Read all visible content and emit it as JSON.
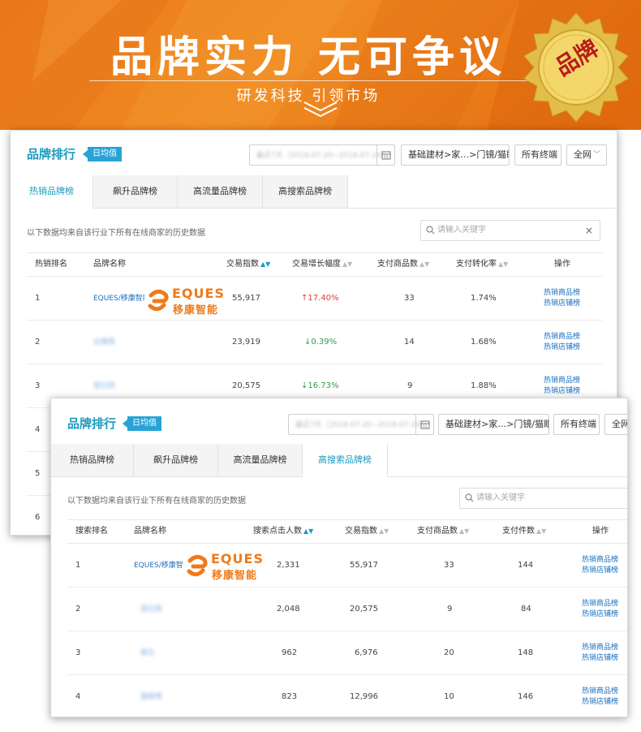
{
  "banner": {
    "title": "品牌实力 无可争议",
    "subtitle": "研发科技 引领市场",
    "seal_text": "品牌",
    "colors": {
      "orange": "#ef7f1a",
      "gold": "#d9b13a",
      "seal_red": "#b71c1c"
    }
  },
  "panel1": {
    "title": "品牌排行",
    "badge": "日均值",
    "date_range": "最近7天（2018-07-20~2018-07-26）",
    "category": "基础建材>家…>门镜/猫眼",
    "terminal": "所有终端",
    "network": "全网",
    "tabs": [
      "热销品牌榜",
      "飙升品牌榜",
      "高流量品牌榜",
      "高搜索品牌榜"
    ],
    "active_tab": 0,
    "note": "以下数据均来自该行业下所有在线商家的历史数据",
    "search_placeholder": "请输入关键字",
    "columns": [
      "热销排名",
      "品牌名称",
      "交易指数",
      "交易增长幅度",
      "支付商品数",
      "支付转化率",
      "操作"
    ],
    "rows": [
      {
        "rank": "1",
        "brand": "EQUES/移康智能",
        "trade_index": "55,917",
        "growth": "17.40%",
        "growth_dir": "up",
        "goods": "33",
        "conv": "1.74%",
        "op1": "热销商品榜",
        "op2": "热销店铺榜"
      },
      {
        "rank": "2",
        "brand": "云瞳等",
        "trade_index": "23,919",
        "growth": "0.39%",
        "growth_dir": "down",
        "goods": "14",
        "conv": "1.68%",
        "op1": "热销商品榜",
        "op2": "热销店铺榜"
      },
      {
        "rank": "3",
        "brand": "萤石购",
        "trade_index": "20,575",
        "growth": "16.73%",
        "growth_dir": "down",
        "goods": "9",
        "conv": "1.88%",
        "op1": "热销商品榜",
        "op2": "热销店铺榜"
      },
      {
        "rank": "4"
      },
      {
        "rank": "5"
      },
      {
        "rank": "6"
      }
    ]
  },
  "panel2": {
    "title": "品牌排行",
    "badge": "日均值",
    "date_range": "最近7天（2018-07-20~2018-07-26）",
    "category": "基础建材>家…>门镜/猫眼",
    "terminal": "所有终端",
    "network": "全网",
    "tabs": [
      "热销品牌榜",
      "飙升品牌榜",
      "高流量品牌榜",
      "高搜索品牌榜"
    ],
    "active_tab": 3,
    "note": "以下数据均来自该行业下所有在线商家的历史数据",
    "search_placeholder": "请输入关键字",
    "columns": [
      "搜索排名",
      "品牌名称",
      "搜索点击人数",
      "交易指数",
      "支付商品数",
      "支付件数",
      "操作"
    ],
    "rows": [
      {
        "rank": "1",
        "brand": "EQUES/移康智能",
        "clicks": "2,331",
        "trade_index": "55,917",
        "goods": "33",
        "pieces": "144",
        "op1": "热销商品榜",
        "op2": "热销店铺榜"
      },
      {
        "rank": "2",
        "brand": "萤石购",
        "clicks": "2,048",
        "trade_index": "20,575",
        "goods": "9",
        "pieces": "84",
        "op1": "热销商品榜",
        "op2": "热销店铺榜"
      },
      {
        "rank": "3",
        "brand": "黄石",
        "clicks": "962",
        "trade_index": "6,976",
        "goods": "20",
        "pieces": "148",
        "op1": "热销商品榜",
        "op2": "热销店铺榜"
      },
      {
        "rank": "4",
        "brand": "猫眼等",
        "clicks": "823",
        "trade_index": "12,996",
        "goods": "10",
        "pieces": "146",
        "op1": "热销商品榜",
        "op2": "热销店铺榜"
      }
    ]
  },
  "logo": {
    "en": "EQUES",
    "cn": "移康智能"
  },
  "icons": [
    "calendar-icon",
    "search-icon",
    "close-icon",
    "chevron-down-icon",
    "sort-icon",
    "arrow-up-icon",
    "arrow-down-icon",
    "eques-logo-icon",
    "seal-icon"
  ]
}
